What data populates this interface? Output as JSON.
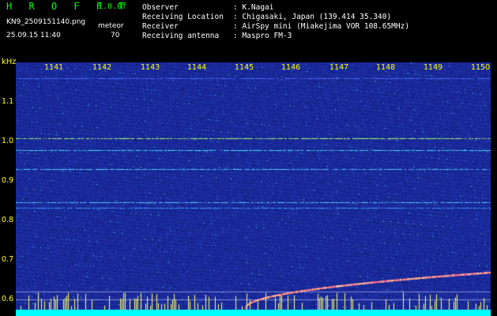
{
  "header": {
    "title": "H R O F F T",
    "version": "1.0.0f",
    "filename": "KN9_2509151140.png",
    "datetime": "25.09.15 11:40",
    "meteor_label": "meteor",
    "meteor_count": "70"
  },
  "info": [
    {
      "key": "Observer",
      "value": ": K.Nagai"
    },
    {
      "key": "Receiving Location",
      "value": ": Chigasaki, Japan (139.414 35.340)"
    },
    {
      "key": "Receiver",
      "value": ": AirSpy mini (Miakejima VOR 108.65MHz)"
    },
    {
      "key": "Receiving antenna",
      "value": ": Maspro FM-3"
    }
  ],
  "axes": {
    "y_unit": "kHz",
    "y_ticks": [
      "1.1",
      "1.0",
      "0.9",
      "0.8",
      "0.7",
      "0.6"
    ],
    "x_ticks": [
      "1141",
      "1142",
      "1143",
      "1144",
      "1145",
      "1146",
      "1147",
      "1148",
      "1149",
      "1150"
    ]
  },
  "colors": {
    "background": "#000000",
    "spectrogram": "#1a2a9a",
    "axis_text": "#ffff00",
    "title": "#00ff00"
  }
}
